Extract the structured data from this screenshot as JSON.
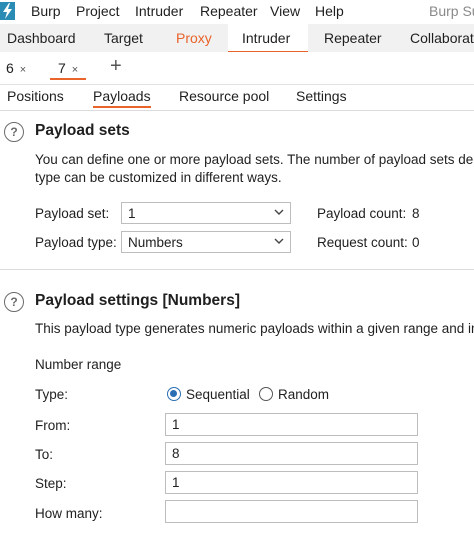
{
  "colors": {
    "accent": "#e8642a",
    "logo": "#2a8bb4",
    "radio": "#2a6fb4"
  },
  "menu": {
    "logo_icon": "burp-lightning-icon",
    "items": [
      "Burp",
      "Project",
      "Intruder",
      "Repeater",
      "View",
      "Help"
    ],
    "app_title": "Burp Su"
  },
  "main_tabs": [
    "Dashboard",
    "Target",
    "Proxy",
    "Intruder",
    "Repeater",
    "Collaborato"
  ],
  "request_tabs": [
    {
      "label": "6",
      "close": "×"
    },
    {
      "label": "7",
      "close": "×"
    }
  ],
  "add_tab": "+",
  "sub_tabs": [
    "Positions",
    "Payloads",
    "Resource pool",
    "Settings"
  ],
  "payload_sets": {
    "help": "?",
    "title": "Payload sets",
    "description_line1": "You can define one or more payload sets. The number of payload sets dep",
    "description_line2": "type can be customized in different ways.",
    "set_label": "Payload set:",
    "set_value": "1",
    "type_label": "Payload type:",
    "type_value": "Numbers",
    "count_label": "Payload count:",
    "count_value": "8",
    "request_label": "Request count:",
    "request_value": "0"
  },
  "payload_settings": {
    "help": "?",
    "title": "Payload settings [Numbers]",
    "description": "This payload type generates numeric payloads within a given range and in",
    "range_heading": "Number range",
    "type_label": "Type:",
    "sequential_label": "Sequential",
    "random_label": "Random",
    "selected": "Sequential",
    "from_label": "From:",
    "from_value": "1",
    "to_label": "To:",
    "to_value": "8",
    "step_label": "Step:",
    "step_value": "1",
    "howmany_label": "How many:",
    "howmany_value": ""
  }
}
